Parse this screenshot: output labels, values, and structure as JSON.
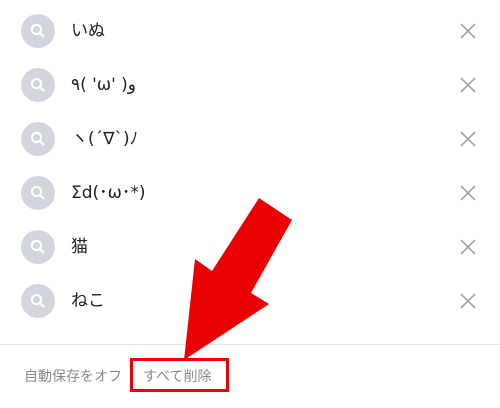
{
  "history": {
    "items": [
      {
        "label": "いぬ",
        "icon": "search-icon",
        "remove_icon": "close-icon"
      },
      {
        "label": "٩( 'ω' )و",
        "icon": "search-icon",
        "remove_icon": "close-icon"
      },
      {
        "label": "ヽ(´∇`)ﾉ",
        "icon": "search-icon",
        "remove_icon": "close-icon"
      },
      {
        "label": "Σd(･ω･*)",
        "icon": "search-icon",
        "remove_icon": "close-icon"
      },
      {
        "label": "猫",
        "icon": "search-icon",
        "remove_icon": "close-icon"
      },
      {
        "label": "ねこ",
        "icon": "search-icon",
        "remove_icon": "close-icon"
      }
    ]
  },
  "footer": {
    "autosave_off_label": "自動保存をオフ",
    "delete_all_label": "すべて削除"
  },
  "annotation": {
    "arrow_color": "#ea0000",
    "highlight_color": "#ea0000"
  }
}
